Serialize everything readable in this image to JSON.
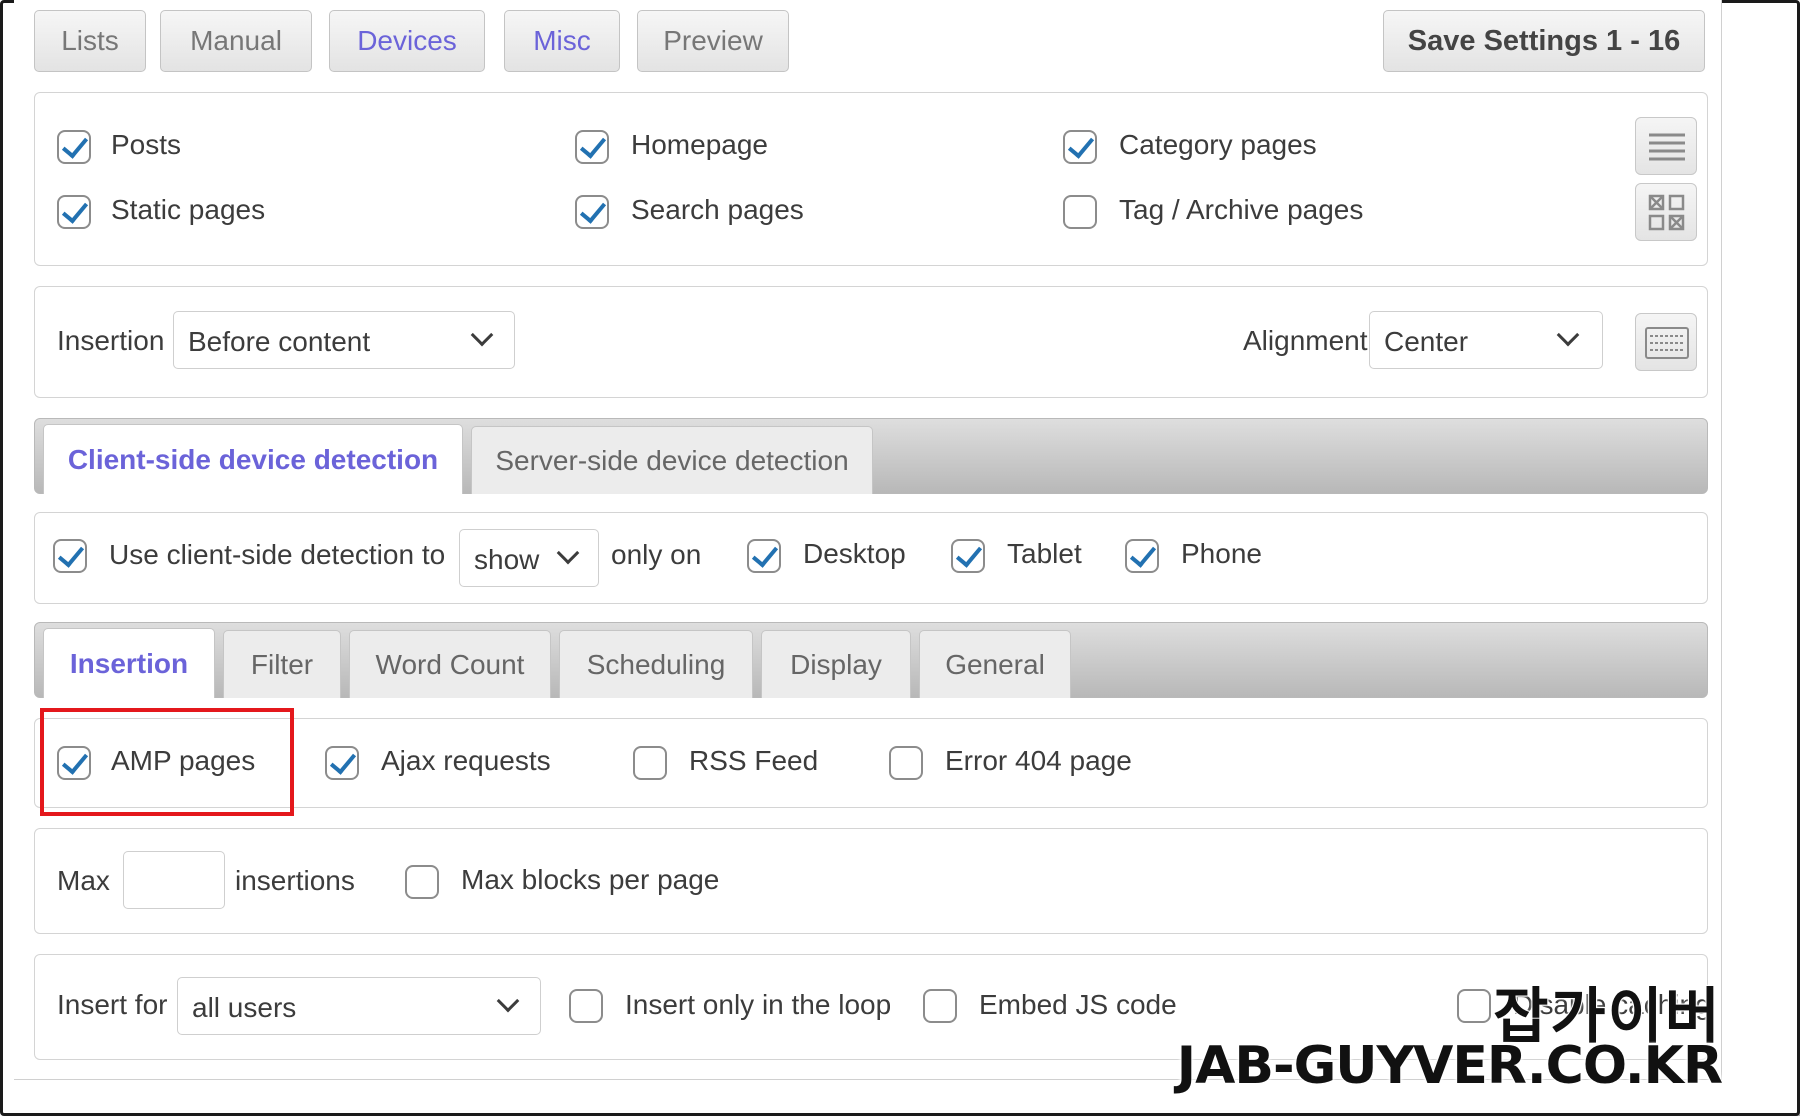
{
  "top_buttons": {
    "lists": "Lists",
    "manual": "Manual",
    "devices": "Devices",
    "misc": "Misc",
    "preview": "Preview",
    "save": "Save Settings 1 - 16"
  },
  "page_types": {
    "posts": {
      "label": "Posts",
      "checked": true
    },
    "homepage": {
      "label": "Homepage",
      "checked": true
    },
    "category_pages": {
      "label": "Category pages",
      "checked": true
    },
    "static_pages": {
      "label": "Static pages",
      "checked": true
    },
    "search_pages": {
      "label": "Search pages",
      "checked": true
    },
    "tag_archive_pages": {
      "label": "Tag / Archive pages",
      "checked": false
    }
  },
  "insertion_row": {
    "insertion_label": "Insertion",
    "insertion_value": "Before content",
    "alignment_label": "Alignment",
    "alignment_value": "Center"
  },
  "detection_tabs": {
    "client": "Client-side device detection",
    "server": "Server-side device detection"
  },
  "client_detection": {
    "use_label": "Use client-side detection to",
    "use_checked": true,
    "mode_value": "show",
    "only_on": "only on",
    "desktop": {
      "label": "Desktop",
      "checked": true
    },
    "tablet": {
      "label": "Tablet",
      "checked": true
    },
    "phone": {
      "label": "Phone",
      "checked": true
    }
  },
  "settings_tabs": [
    "Insertion",
    "Filter",
    "Word Count",
    "Scheduling",
    "Display",
    "General"
  ],
  "insertion_options": {
    "amp": {
      "label": "AMP pages",
      "checked": true
    },
    "ajax": {
      "label": "Ajax requests",
      "checked": true
    },
    "rss": {
      "label": "RSS Feed",
      "checked": false
    },
    "error404": {
      "label": "Error 404 page",
      "checked": false
    }
  },
  "max_row": {
    "max_label": "Max",
    "max_value": "",
    "insertions_label": "insertions",
    "max_blocks_label": "Max blocks per page",
    "max_blocks_checked": false
  },
  "insert_for_row": {
    "insert_for_label": "Insert for",
    "insert_for_value": "all users",
    "loop_label": "Insert only in the loop",
    "embed_label": "Embed JS code",
    "debug_label": "Disable caching"
  },
  "watermark": {
    "line1": "잡가이버",
    "line2": "JAB-GUYVER.CO.KR"
  },
  "colors": {
    "accent": "#6b63d9",
    "checkmark": "#2271b1",
    "highlight": "#e4181c"
  }
}
